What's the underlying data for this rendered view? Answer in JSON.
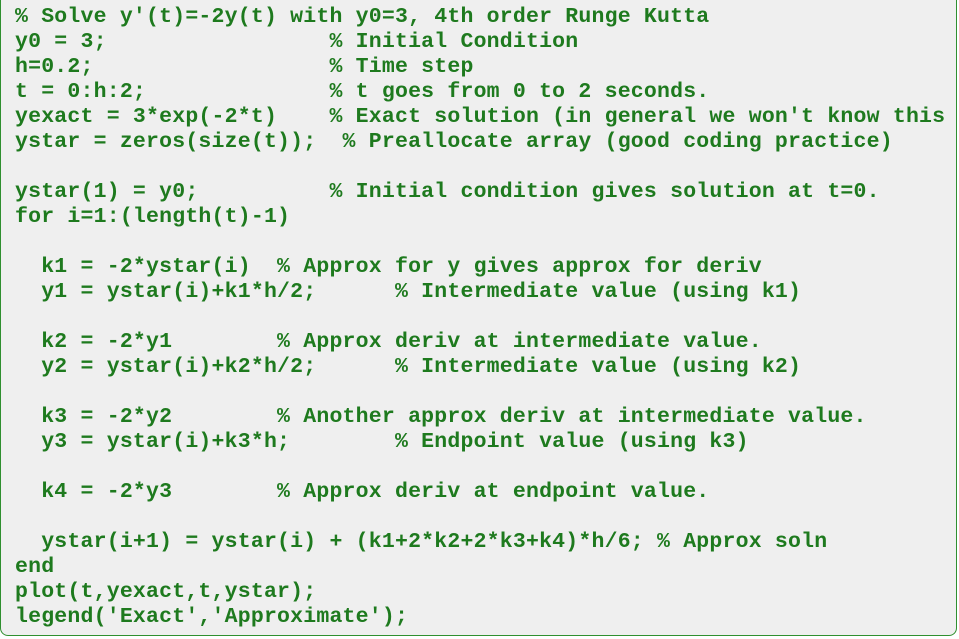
{
  "code": {
    "lines": [
      "% Solve y'(t)=-2y(t) with y0=3, 4th order Runge Kutta",
      "y0 = 3;                 % Initial Condition",
      "h=0.2;                  % Time step",
      "t = 0:h:2;              % t goes from 0 to 2 seconds.",
      "yexact = 3*exp(-2*t)    % Exact solution (in general we won't know this",
      "ystar = zeros(size(t));  % Preallocate array (good coding practice)",
      "",
      "ystar(1) = y0;          % Initial condition gives solution at t=0.",
      "for i=1:(length(t)-1)",
      "",
      "  k1 = -2*ystar(i)  % Approx for y gives approx for deriv",
      "  y1 = ystar(i)+k1*h/2;      % Intermediate value (using k1)",
      "",
      "  k2 = -2*y1        % Approx deriv at intermediate value.",
      "  y2 = ystar(i)+k2*h/2;      % Intermediate value (using k2)",
      "",
      "  k3 = -2*y2        % Another approx deriv at intermediate value.",
      "  y3 = ystar(i)+k3*h;        % Endpoint value (using k3)",
      "",
      "  k4 = -2*y3        % Approx deriv at endpoint value.",
      "",
      "  ystar(i+1) = ystar(i) + (k1+2*k2+2*k3+k4)*h/6; % Approx soln",
      "end",
      "plot(t,yexact,t,ystar);",
      "legend('Exact','Approximate');"
    ]
  }
}
